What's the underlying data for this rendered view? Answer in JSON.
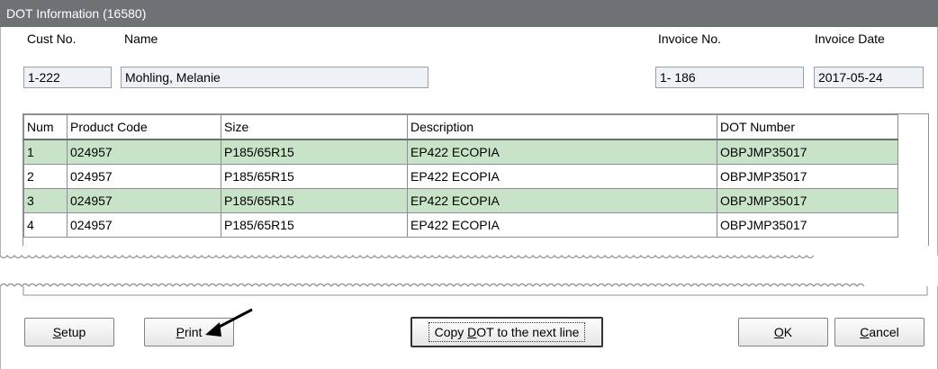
{
  "window": {
    "title": "DOT Information (16580)"
  },
  "customer": {
    "cust_no_label": "Cust No.",
    "cust_no": "1-222",
    "name_label": "Name",
    "name": "Mohling, Melanie"
  },
  "invoice": {
    "no_label": "Invoice No.",
    "no": "1- 186",
    "date_label": "Invoice Date",
    "date": "2017-05-24"
  },
  "table": {
    "headers": [
      "Num",
      "Product Code",
      "Size",
      "Description",
      "DOT Number"
    ],
    "rows": [
      [
        "1",
        "024957",
        "P185/65R15",
        "EP422 ECOPIA",
        "OBPJMP35017"
      ],
      [
        "2",
        "024957",
        "P185/65R15",
        "EP422 ECOPIA",
        "OBPJMP35017"
      ],
      [
        "3",
        "024957",
        "P185/65R15",
        "EP422 ECOPIA",
        "OBPJMP35017"
      ],
      [
        "4",
        "024957",
        "P185/65R15",
        "EP422 ECOPIA",
        "OBPJMP35017"
      ]
    ]
  },
  "buttons": {
    "setup_pre": "",
    "setup_key": "S",
    "setup_post": "etup",
    "print_pre": "",
    "print_key": "P",
    "print_post": "rint",
    "copy_pre": "Copy ",
    "copy_key": "D",
    "copy_post": "OT to the next line",
    "ok_pre": "",
    "ok_key": "O",
    "ok_post": "K",
    "cancel_pre": "",
    "cancel_key": "C",
    "cancel_post": "ancel"
  },
  "colors": {
    "titlebar": "#6d7275",
    "selected_row": "#c8e3c8",
    "field_bg": "#eef2f6"
  }
}
